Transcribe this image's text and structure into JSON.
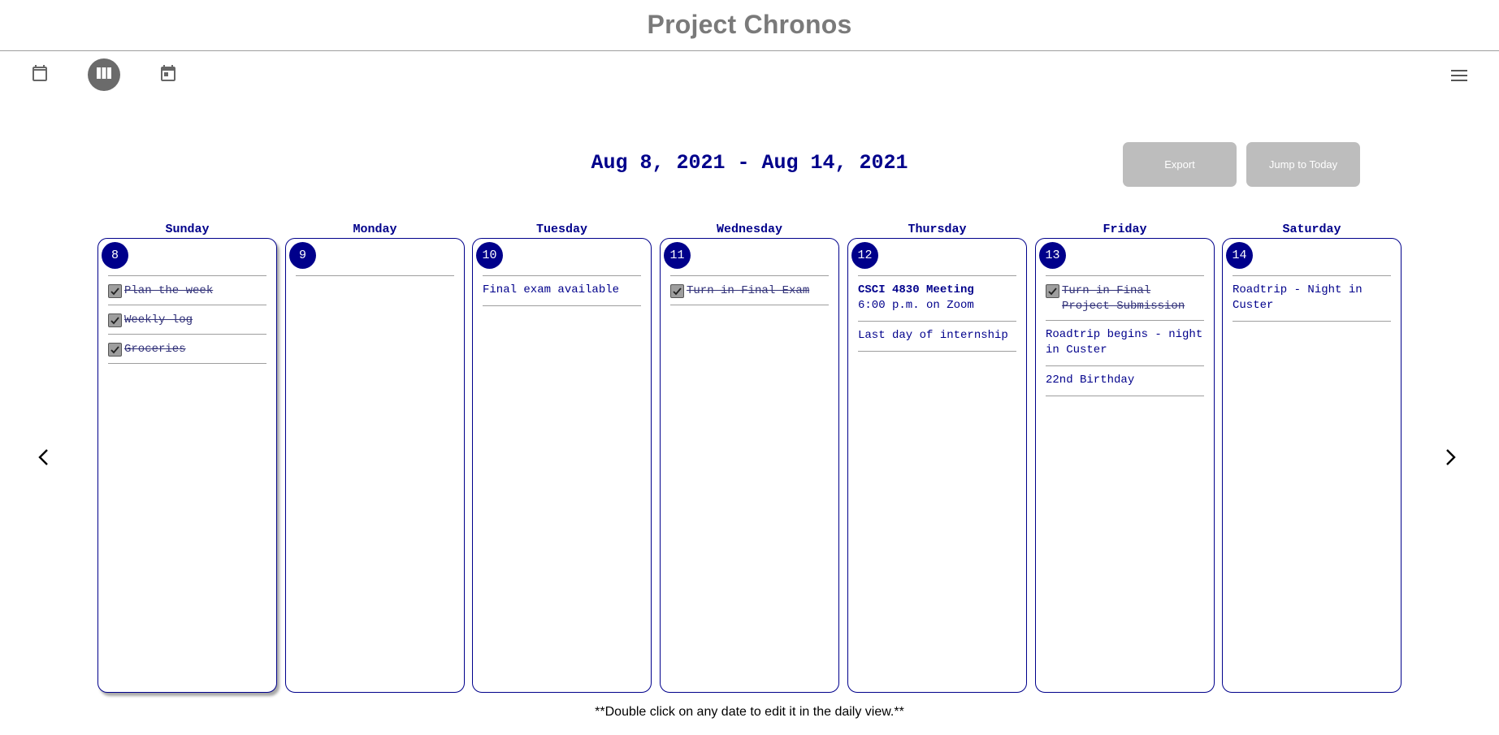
{
  "app": {
    "title": "Project Chronos"
  },
  "toolbar": {
    "views": [
      {
        "icon": "calendar-month-icon"
      },
      {
        "icon": "view-week-icon"
      },
      {
        "icon": "calendar-day-icon"
      }
    ],
    "menu_icon": "menu-icon"
  },
  "week": {
    "range_label": "Aug 8, 2021 - Aug 14, 2021",
    "export_label": "Export",
    "jump_today_label": "Jump to Today"
  },
  "colors": {
    "accent": "#00008b",
    "button_gray": "#bdbdbd",
    "title_gray": "#7a7a7a"
  },
  "days": [
    {
      "name": "Sunday",
      "number": "8",
      "items": [
        {
          "type": "task",
          "done": true,
          "text": "Plan the week"
        },
        {
          "type": "task",
          "done": true,
          "text": "Weekly log"
        },
        {
          "type": "task",
          "done": true,
          "text": "Groceries"
        }
      ]
    },
    {
      "name": "Monday",
      "number": "9",
      "items": []
    },
    {
      "name": "Tuesday",
      "number": "10",
      "items": [
        {
          "type": "note",
          "text": "Final exam available"
        }
      ]
    },
    {
      "name": "Wednesday",
      "number": "11",
      "items": [
        {
          "type": "task",
          "done": true,
          "text": "Turn in Final Exam"
        }
      ]
    },
    {
      "name": "Thursday",
      "number": "12",
      "items": [
        {
          "type": "event",
          "title": "CSCI 4830 Meeting",
          "detail": "6:00 p.m. on Zoom"
        },
        {
          "type": "note",
          "text": "Last day of internship"
        }
      ]
    },
    {
      "name": "Friday",
      "number": "13",
      "items": [
        {
          "type": "task",
          "done": true,
          "text": "Turn in Final Project Submission"
        },
        {
          "type": "note",
          "text": "Roadtrip begins - night in Custer"
        },
        {
          "type": "note",
          "text": "22nd Birthday"
        }
      ]
    },
    {
      "name": "Saturday",
      "number": "14",
      "items": [
        {
          "type": "note",
          "text": "Roadtrip - Night in Custer"
        }
      ]
    }
  ],
  "footer": {
    "note": "**Double click on any date to edit it in the daily view.**"
  }
}
